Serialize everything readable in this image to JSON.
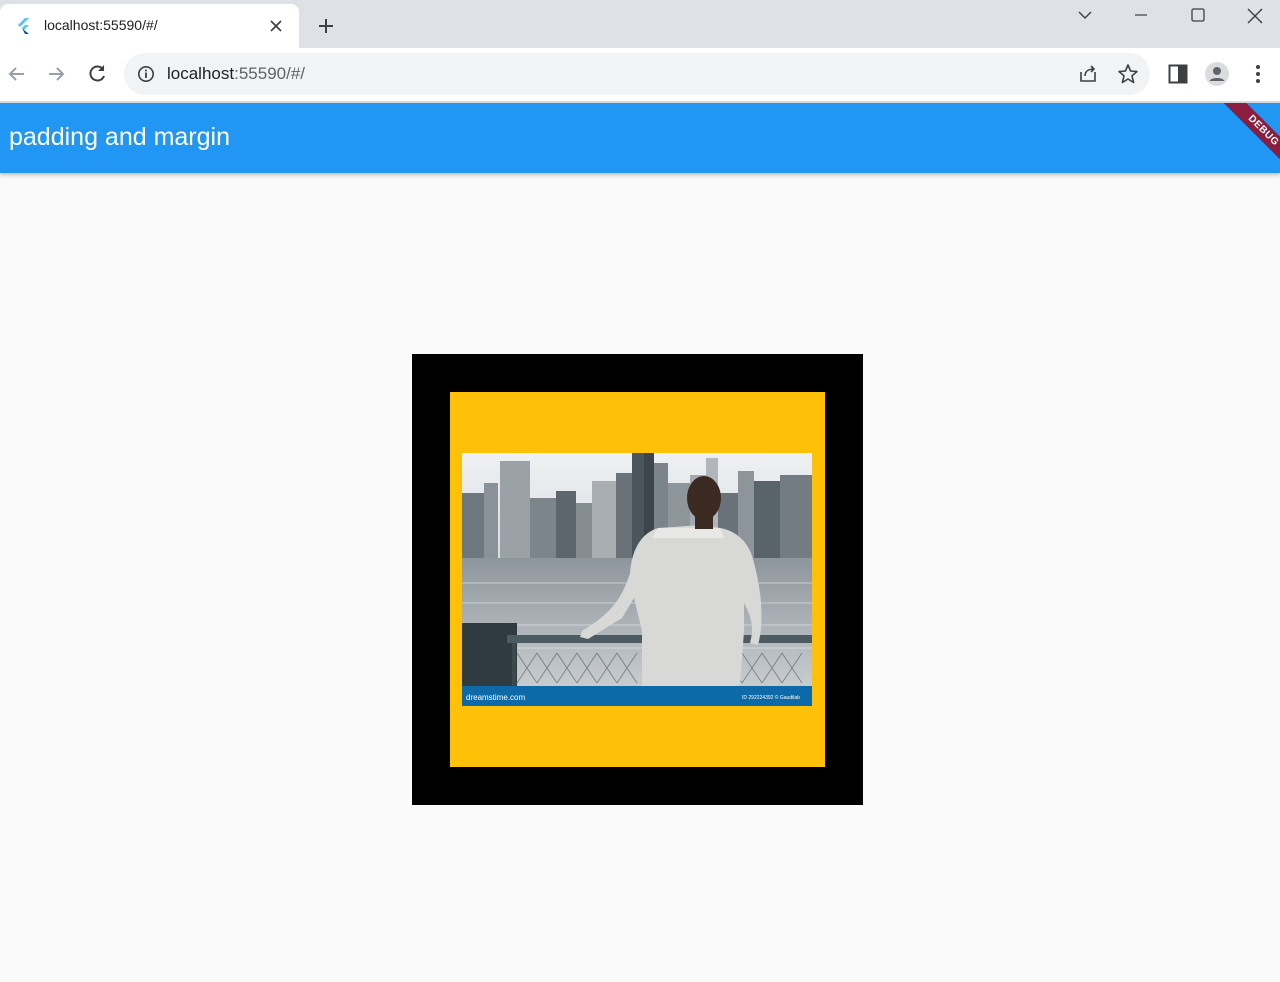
{
  "browser": {
    "tab_title": "localhost:55590/#/",
    "url_host": "localhost",
    "url_rest": ":55590/#/"
  },
  "app": {
    "title": "padding and margin",
    "debug_label": "DEBUG",
    "appbar_color": "#2196f3",
    "outer_color": "#000000",
    "inner_color": "#ffc107"
  },
  "photo": {
    "watermark_left": "dreamstime.com",
    "watermark_right": "ID 292224392 © Gaudilab"
  },
  "icons": {
    "back": "back-arrow-icon",
    "forward": "forward-arrow-icon",
    "reload": "reload-icon",
    "info": "info-icon",
    "share": "share-icon",
    "bookmark": "star-icon",
    "side_panel": "side-panel-icon",
    "profile": "profile-icon",
    "menu": "kebab-menu-icon"
  }
}
